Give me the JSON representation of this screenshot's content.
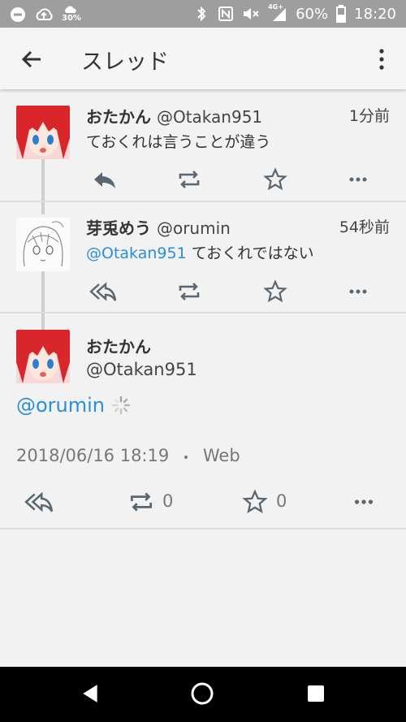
{
  "status": {
    "battery_small": "30%",
    "battery": "60%",
    "time": "18:20",
    "network": "4G+"
  },
  "appbar": {
    "title": "スレッド"
  },
  "posts": [
    {
      "name": "おたかん",
      "handle": "@Otakan951",
      "time": "1分前",
      "text": "ておくれは言うことが違う"
    },
    {
      "name": "芽兎めう",
      "handle": "@orumin",
      "time": "54秒前",
      "mention": "@Otakan951",
      "text": " ておくれではない"
    }
  ],
  "main": {
    "name": "おたかん",
    "handle": "@Otakan951",
    "mention": "@orumin",
    "timestamp": "2018/06/16 18:19",
    "separator": "•",
    "source": "Web",
    "retweet_count": "0",
    "like_count": "0"
  },
  "colors": {
    "accent": "#2b8ed8",
    "statusbar": "#9e9e9e"
  }
}
